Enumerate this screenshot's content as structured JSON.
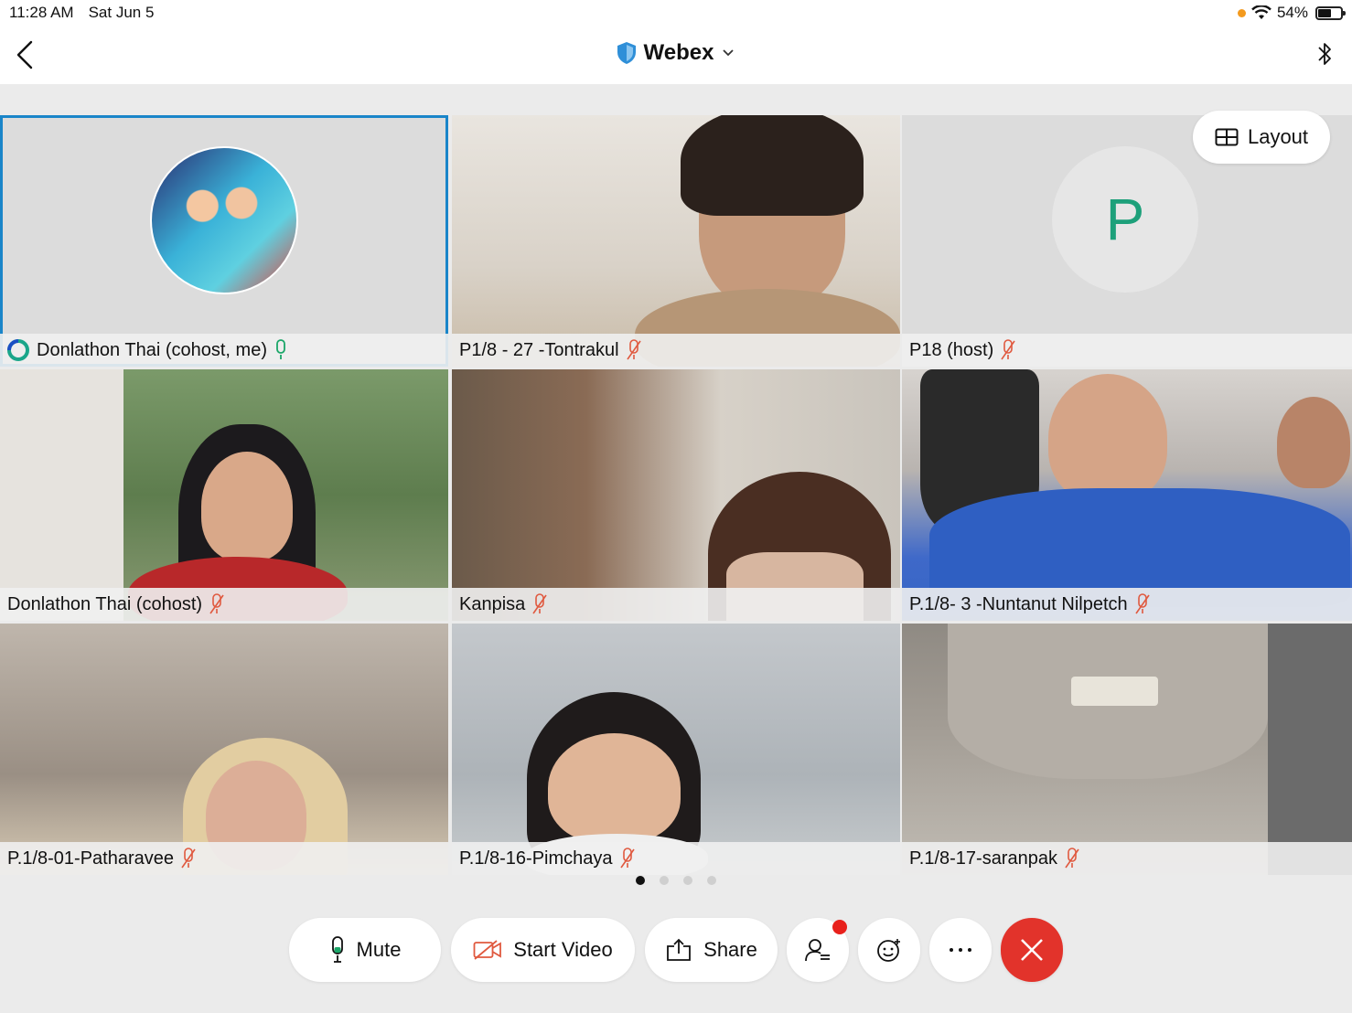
{
  "status_bar": {
    "time": "11:28 AM",
    "date": "Sat Jun 5",
    "battery": "54%"
  },
  "header": {
    "title": "Webex"
  },
  "layout_button": {
    "label": "Layout"
  },
  "participants": [
    {
      "name": "Donlathon Thai (cohost, me)",
      "mic": "on",
      "active": true
    },
    {
      "name": "P1/8 - 27 -Tontrakul",
      "mic": "muted"
    },
    {
      "name": "P18 (host)",
      "mic": "muted",
      "avatar_letter": "P"
    },
    {
      "name": "Donlathon Thai (cohost)",
      "mic": "muted"
    },
    {
      "name": "Kanpisa",
      "mic": "muted"
    },
    {
      "name": "P.1/8- 3 -Nuntanut Nilpetch",
      "mic": "muted"
    },
    {
      "name": "P.1/8-01-Patharavee",
      "mic": "muted"
    },
    {
      "name": "P.1/8-16-Pimchaya",
      "mic": "muted"
    },
    {
      "name": "P.1/8-17-saranpak",
      "mic": "muted"
    }
  ],
  "pager": {
    "pages": 4,
    "current": 1
  },
  "controls": {
    "mute": "Mute",
    "start_video": "Start Video",
    "share": "Share"
  },
  "colors": {
    "accent": "#1a85c9",
    "muted_mic": "#e0593f",
    "end_call": "#e2332b",
    "avatar_letter": "#1da07a"
  }
}
